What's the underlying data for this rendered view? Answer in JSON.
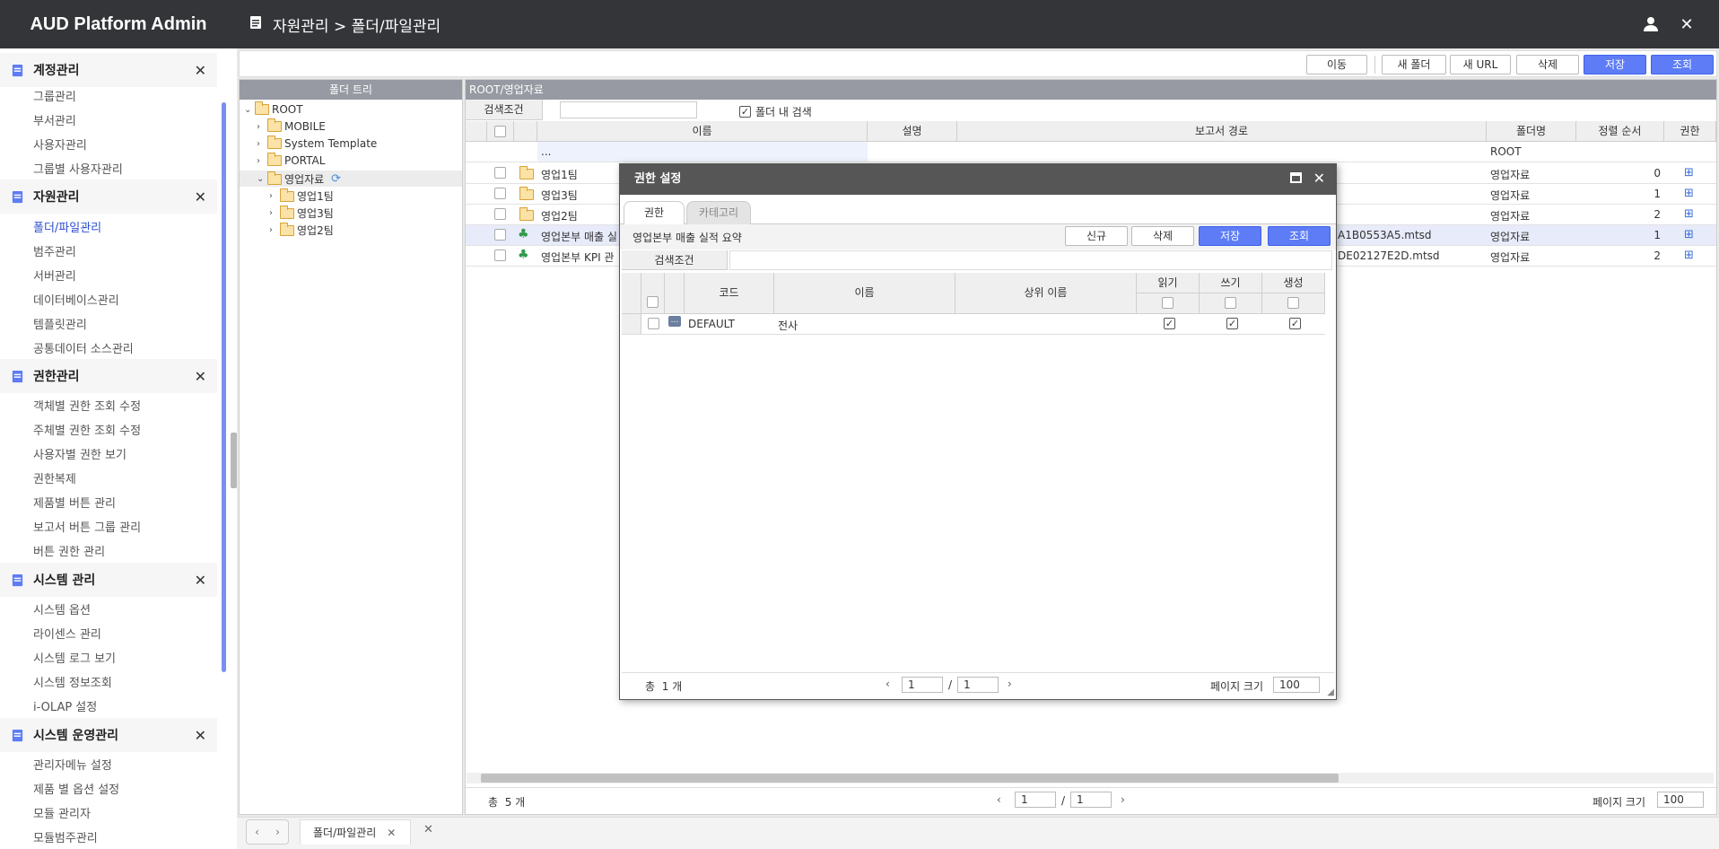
{
  "app": {
    "title": "AUD Platform Admin"
  },
  "breadcrumb": "자원관리 > 폴더/파일관리",
  "sidebar": {
    "sections": [
      {
        "title": "계정관리",
        "items": [
          "그룹관리",
          "부서관리",
          "사용자관리",
          "그룹별 사용자관리"
        ]
      },
      {
        "title": "자원관리",
        "items": [
          "폴더/파일관리",
          "범주관리",
          "서버관리",
          "데이터베이스관리",
          "템플릿관리",
          "공통데이터 소스관리"
        ]
      },
      {
        "title": "권한관리",
        "items": [
          "객체별 권한 조회 수정",
          "주체별 권한 조회 수정",
          "사용자별 권한 보기",
          "권한복제",
          "제품별 버튼 관리",
          "보고서 버튼 그룹 관리",
          "버튼 권한 관리"
        ]
      },
      {
        "title": "시스템 관리",
        "items": [
          "시스템 옵션",
          "라이센스 관리",
          "시스템 로그 보기",
          "시스템 정보조회",
          "i-OLAP 설정"
        ]
      },
      {
        "title": "시스템 운영관리",
        "items": [
          "관리자메뉴 설정",
          "제품 별 옵션 설정",
          "모듈 관리자",
          "모듈범주관리"
        ]
      }
    ]
  },
  "toolbar": {
    "move": "이동",
    "new_folder": "새 폴더",
    "new_url": "새 URL",
    "delete": "삭제",
    "save": "저장",
    "search": "조회"
  },
  "tree": {
    "title": "폴더 트리",
    "nodes": [
      "ROOT",
      "MOBILE",
      "System Template",
      "PORTAL",
      "영업자료",
      "영업1팀",
      "영업3팀",
      "영업2팀"
    ]
  },
  "grid": {
    "path": "ROOT/영업자료",
    "search_label": "검색조건",
    "search_in_folder": "폴더 내 검색",
    "columns": [
      "이름",
      "설명",
      "보고서 경로",
      "폴더명",
      "정렬 순서",
      "권한"
    ],
    "rows": [
      {
        "name": "...",
        "path": "",
        "folder": "ROOT",
        "order": ""
      },
      {
        "name": "영업1팀",
        "path": "",
        "folder": "영업자료",
        "order": "0"
      },
      {
        "name": "영업3팀",
        "path": "",
        "folder": "영업자료",
        "order": "1"
      },
      {
        "name": "영업2팀",
        "path": "",
        "folder": "영업자료",
        "order": "2"
      },
      {
        "name": "영업본부 매출 실",
        "path": "A1B0553A5.mtsd",
        "folder": "영업자료",
        "order": "1"
      },
      {
        "name": "영업본부 KPI 관",
        "path": "DE02127E2D.mtsd",
        "folder": "영업자료",
        "order": "2"
      }
    ],
    "total_label": "총",
    "total_count": "5 개",
    "page": "1",
    "pages": "1",
    "page_size_label": "페이지 크기",
    "page_size": "100"
  },
  "bottom_tab": {
    "label": "폴더/파일관리"
  },
  "dialog": {
    "title": "권한 설정",
    "tabs": [
      "권한",
      "카테고리"
    ],
    "subject": "영업본부 매출 실적 요약",
    "buttons": {
      "new": "신규",
      "delete": "삭제",
      "save": "저장",
      "search": "조회"
    },
    "search_label": "검색조건",
    "columns": [
      "코드",
      "이름",
      "상위 이름",
      "읽기",
      "쓰기",
      "생성"
    ],
    "rows": [
      {
        "code": "DEFAULT",
        "name": "전사",
        "parent": "",
        "read": true,
        "write": true,
        "create": true
      }
    ],
    "total_label": "총",
    "total_count": "1 개",
    "page": "1",
    "pages": "1",
    "page_size_label": "페이지 크기",
    "page_size": "100"
  },
  "colors": {
    "accent": "#5d7cf6",
    "header": "#333539",
    "panel_head": "#979aa2"
  }
}
